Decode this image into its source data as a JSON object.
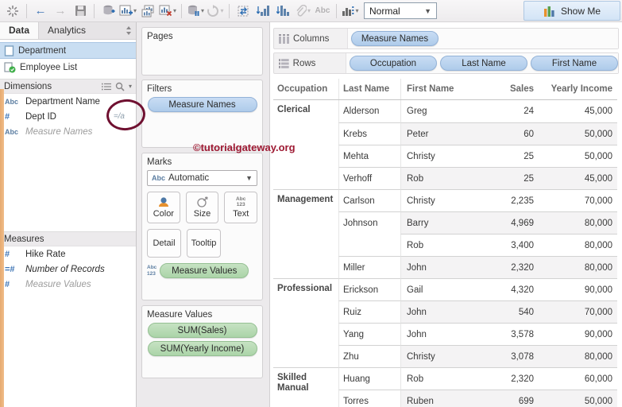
{
  "toolbar": {
    "fit_mode": "Normal",
    "show_me": "Show Me",
    "abc_label": "Abc"
  },
  "sidebar": {
    "tabs": {
      "data": "Data",
      "analytics": "Analytics"
    },
    "data_sources": [
      {
        "name": "Department",
        "selected": true
      },
      {
        "name": "Employee List",
        "selected": false
      }
    ],
    "dimensions_header": "Dimensions",
    "dimension_fields": [
      {
        "icon": "Abc",
        "name": "Department Name",
        "style": "normal"
      },
      {
        "icon": "#",
        "name": "Dept ID",
        "style": "normal",
        "annotation": "=/a"
      },
      {
        "icon": "Abc",
        "name": "Measure Names",
        "style": "italic-gray"
      }
    ],
    "measures_header": "Measures",
    "measure_fields": [
      {
        "icon": "#",
        "name": "Hike Rate",
        "style": "normal"
      },
      {
        "icon": "=#",
        "name": "Number of Records",
        "style": "italic"
      },
      {
        "icon": "#",
        "name": "Measure Values",
        "style": "italic-gray"
      }
    ]
  },
  "cards": {
    "pages": {
      "title": "Pages"
    },
    "filters": {
      "title": "Filters",
      "pills": [
        "Measure Names"
      ]
    },
    "marks": {
      "title": "Marks",
      "mark_type_prefix": "Abc",
      "mark_type": "Automatic",
      "buttons": {
        "color": "Color",
        "size": "Size",
        "text": "Text",
        "detail": "Detail",
        "tooltip": "Tooltip"
      },
      "text_icon_top": "Abc",
      "text_icon_bottom": "123",
      "pills": [
        "Measure Values"
      ]
    },
    "measure_values": {
      "title": "Measure Values",
      "pills": [
        "SUM(Sales)",
        "SUM(Yearly Income)"
      ]
    }
  },
  "watermark": "©tutorialgateway.org",
  "annotation": {
    "label": "=/a"
  },
  "shelves": {
    "columns_label": "Columns",
    "columns_pills": [
      "Measure Names"
    ],
    "rows_label": "Rows",
    "rows_pills": [
      "Occupation",
      "Last Name",
      "First Name"
    ]
  },
  "table": {
    "headers": [
      "Occupation",
      "Last Name",
      "First Name",
      "Sales",
      "Yearly Income"
    ],
    "rows": [
      {
        "occ": "Clerical",
        "last": "Alderson",
        "first": "Greg",
        "sales": "24",
        "income": "45,000",
        "sep": "none",
        "band": false
      },
      {
        "occ": "",
        "last": "Krebs",
        "first": "Peter",
        "sales": "60",
        "income": "50,000",
        "sep": "last",
        "band": true
      },
      {
        "occ": "",
        "last": "Mehta",
        "first": "Christy",
        "sales": "25",
        "income": "50,000",
        "sep": "last",
        "band": false
      },
      {
        "occ": "",
        "last": "Verhoff",
        "first": "Rob",
        "sales": "25",
        "income": "45,000",
        "sep": "last",
        "band": true
      },
      {
        "occ": "Management",
        "last": "Carlson",
        "first": "Christy",
        "sales": "2,235",
        "income": "70,000",
        "sep": "occ",
        "band": false
      },
      {
        "occ": "",
        "last": "Johnson",
        "first": "Barry",
        "sales": "4,969",
        "income": "80,000",
        "sep": "last",
        "band": true
      },
      {
        "occ": "",
        "last": "",
        "first": "Rob",
        "sales": "3,400",
        "income": "80,000",
        "sep": "first",
        "band": false
      },
      {
        "occ": "",
        "last": "Miller",
        "first": "John",
        "sales": "2,320",
        "income": "80,000",
        "sep": "last",
        "band": true
      },
      {
        "occ": "Professional",
        "last": "Erickson",
        "first": "Gail",
        "sales": "4,320",
        "income": "90,000",
        "sep": "occ",
        "band": false
      },
      {
        "occ": "",
        "last": "Ruiz",
        "first": "John",
        "sales": "540",
        "income": "70,000",
        "sep": "last",
        "band": true
      },
      {
        "occ": "",
        "last": "Yang",
        "first": "John",
        "sales": "3,578",
        "income": "90,000",
        "sep": "last",
        "band": false
      },
      {
        "occ": "",
        "last": "Zhu",
        "first": "Christy",
        "sales": "3,078",
        "income": "80,000",
        "sep": "last",
        "band": true
      },
      {
        "occ": "Skilled Manual",
        "last": "Huang",
        "first": "Rob",
        "sales": "2,320",
        "income": "60,000",
        "sep": "occ",
        "band": false
      },
      {
        "occ": "",
        "last": "Torres",
        "first": "Ruben",
        "sales": "699",
        "income": "50,000",
        "sep": "last",
        "band": true
      }
    ]
  },
  "colors": {
    "pill_blue": "#b7d0ec",
    "pill_green": "#b5d9b2",
    "selection_blue": "#c9def2",
    "watermark_red": "#9e1a33",
    "annotation_maroon": "#6f1030",
    "show_me_bg": "#dce8f6",
    "band_gray": "#f4f3f4",
    "orange_strip": "#eab378"
  }
}
